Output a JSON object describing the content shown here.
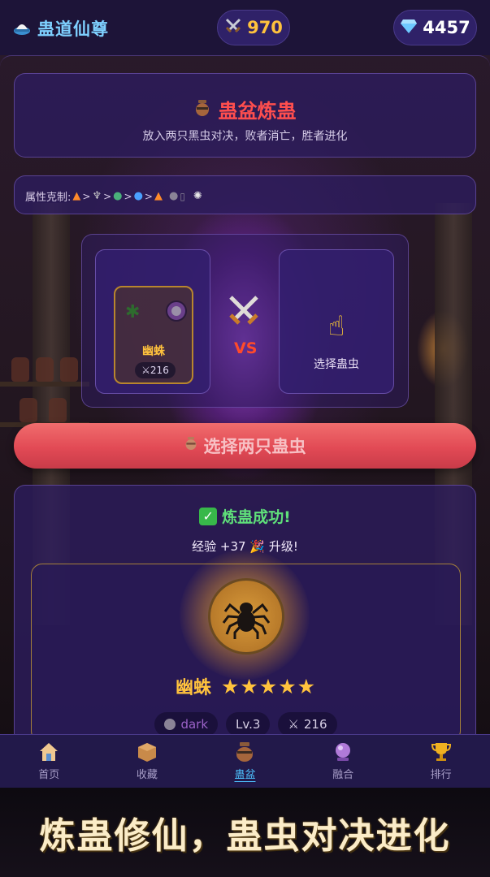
{
  "app": {
    "title": "蛊道仙尊",
    "power_value": "970",
    "gems_value": "4457"
  },
  "header": {
    "title": "蛊盆炼蛊",
    "subtitle": "放入两只黑虫对决，败者消亡，胜者进化"
  },
  "relations": {
    "label": "属性克制:",
    "chain": ">  >  >  >"
  },
  "arena": {
    "left_bug": {
      "name": "幽蛛",
      "attack": "216"
    },
    "vs_label": "VS",
    "right_slot_label": "选择蛊虫"
  },
  "action_button": {
    "label": "选择两只蛊虫"
  },
  "result": {
    "title": "炼蛊成功!",
    "exp_text": "经验 +37",
    "levelup_text": "升级!",
    "bug_name": "幽蛛",
    "stars": "★★★★★",
    "star_count": 5,
    "element": "dark",
    "level": "Lv.3",
    "attack": "216"
  },
  "nav": {
    "items": [
      {
        "label": "首页",
        "icon": "house-icon"
      },
      {
        "label": "收藏",
        "icon": "box-icon"
      },
      {
        "label": "蛊盆",
        "icon": "pot-icon",
        "active": true
      },
      {
        "label": "融合",
        "icon": "crystal-ball-icon"
      },
      {
        "label": "排行",
        "icon": "trophy-icon"
      }
    ]
  },
  "banner": {
    "text": "炼蛊修仙，蛊虫对决进化"
  },
  "colors": {
    "title_blue": "#7ed0ff",
    "gold": "#ffc23d",
    "red_title": "#ff4e4e",
    "success_green": "#5fe07a",
    "active_nav": "#4ec2ff"
  }
}
